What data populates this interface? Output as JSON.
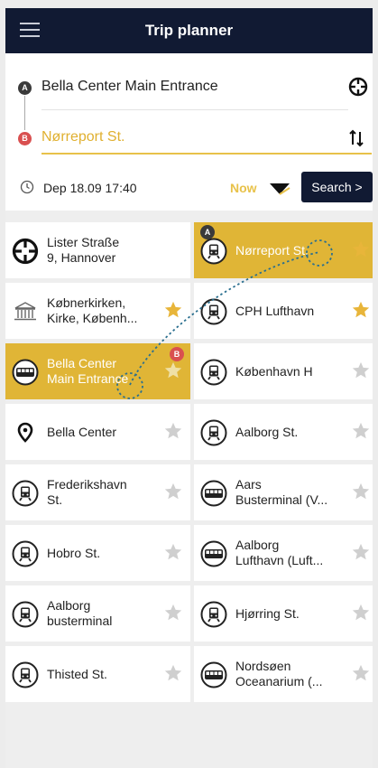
{
  "header": {
    "title": "Trip planner"
  },
  "form": {
    "from_marker": "A",
    "to_marker": "B",
    "from_value": "Bella Center Main Entrance",
    "to_value": "Nørreport St.",
    "date": "Dep 18.09 17:40",
    "now_label": "Now",
    "search_label": "Search >"
  },
  "tiles": [
    {
      "lines": [
        "Lister Straße",
        "9, Hannover"
      ],
      "icon": "crosshair-icon",
      "star": "none"
    },
    {
      "lines": [
        "Nørreport St."
      ],
      "icon": "train-icon",
      "star": "gold",
      "selected": true,
      "badge": "A"
    },
    {
      "lines": [
        "Købnerkirken,",
        "Kirke, Københ..."
      ],
      "icon": "museum-icon",
      "star": "gold"
    },
    {
      "lines": [
        "CPH Lufthavn"
      ],
      "icon": "train-icon",
      "star": "gold"
    },
    {
      "lines": [
        "Bella Center",
        "Main Entrance"
      ],
      "icon": "bus-icon",
      "star": "light",
      "selected": true,
      "badge": "B"
    },
    {
      "lines": [
        "København H"
      ],
      "icon": "train-icon",
      "star": "grey"
    },
    {
      "lines": [
        "Bella Center"
      ],
      "icon": "pin-icon",
      "star": "grey"
    },
    {
      "lines": [
        "Aalborg St."
      ],
      "icon": "train-icon",
      "star": "grey"
    },
    {
      "lines": [
        "Frederikshavn",
        "St."
      ],
      "icon": "train-icon",
      "star": "grey"
    },
    {
      "lines": [
        "Aars",
        "Busterminal (V..."
      ],
      "icon": "bus-icon",
      "star": "grey"
    },
    {
      "lines": [
        "Hobro St."
      ],
      "icon": "train-icon",
      "star": "grey"
    },
    {
      "lines": [
        "Aalborg",
        "Lufthavn (Luft..."
      ],
      "icon": "bus-icon",
      "star": "grey"
    },
    {
      "lines": [
        "Aalborg",
        "busterminal"
      ],
      "icon": "train-icon",
      "star": "grey"
    },
    {
      "lines": [
        "Hjørring St."
      ],
      "icon": "train-icon",
      "star": "grey"
    },
    {
      "lines": [
        "Thisted St."
      ],
      "icon": "train-icon",
      "star": "grey"
    },
    {
      "lines": [
        "Nordsøen",
        "Oceanarium (..."
      ],
      "icon": "bus-icon",
      "star": "grey"
    }
  ],
  "colors": {
    "header_bg": "#111a33",
    "accent": "#e0b536",
    "star_gold": "#e8b53a",
    "star_grey": "#cfcfcf",
    "marker_b": "#d95050"
  }
}
